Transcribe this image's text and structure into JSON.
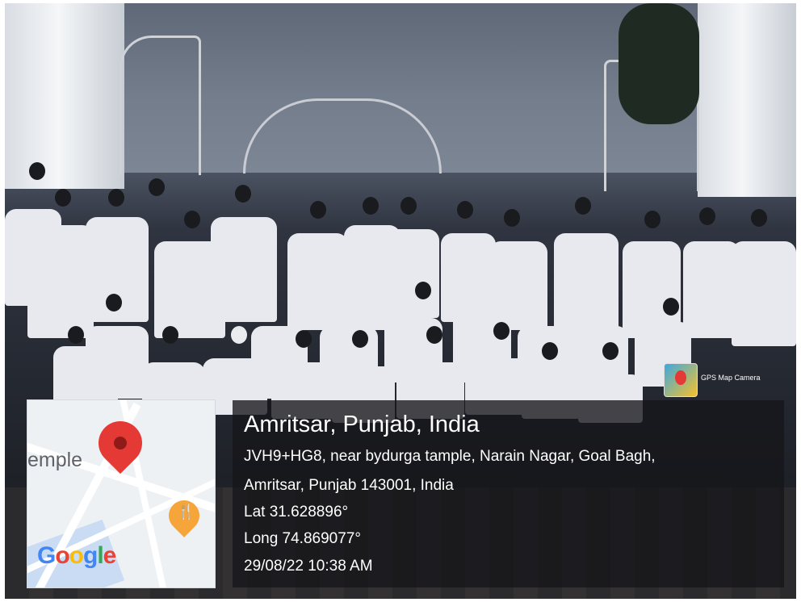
{
  "overlay": {
    "title": "Amritsar, Punjab, India",
    "address_line1": "JVH9+HG8, near bydurga tample, Narain Nagar, Goal Bagh,",
    "address_line2": "Amritsar, Punjab 143001, India",
    "latitude": "Lat 31.628896°",
    "longitude": "Long 74.869077°",
    "timestamp": "29/08/22 10:38 AM"
  },
  "map": {
    "place_label": "emple",
    "logo": [
      "G",
      "o",
      "o",
      "g",
      "l",
      "e"
    ],
    "pin_icon": "map-pin-icon",
    "food_icon": "restaurant-pin-icon",
    "pin_color": "#e53935",
    "food_pin_color": "#f6a53a"
  },
  "app_badge": {
    "label": "GPS Map Camera",
    "icon": "gps-map-camera-icon"
  }
}
